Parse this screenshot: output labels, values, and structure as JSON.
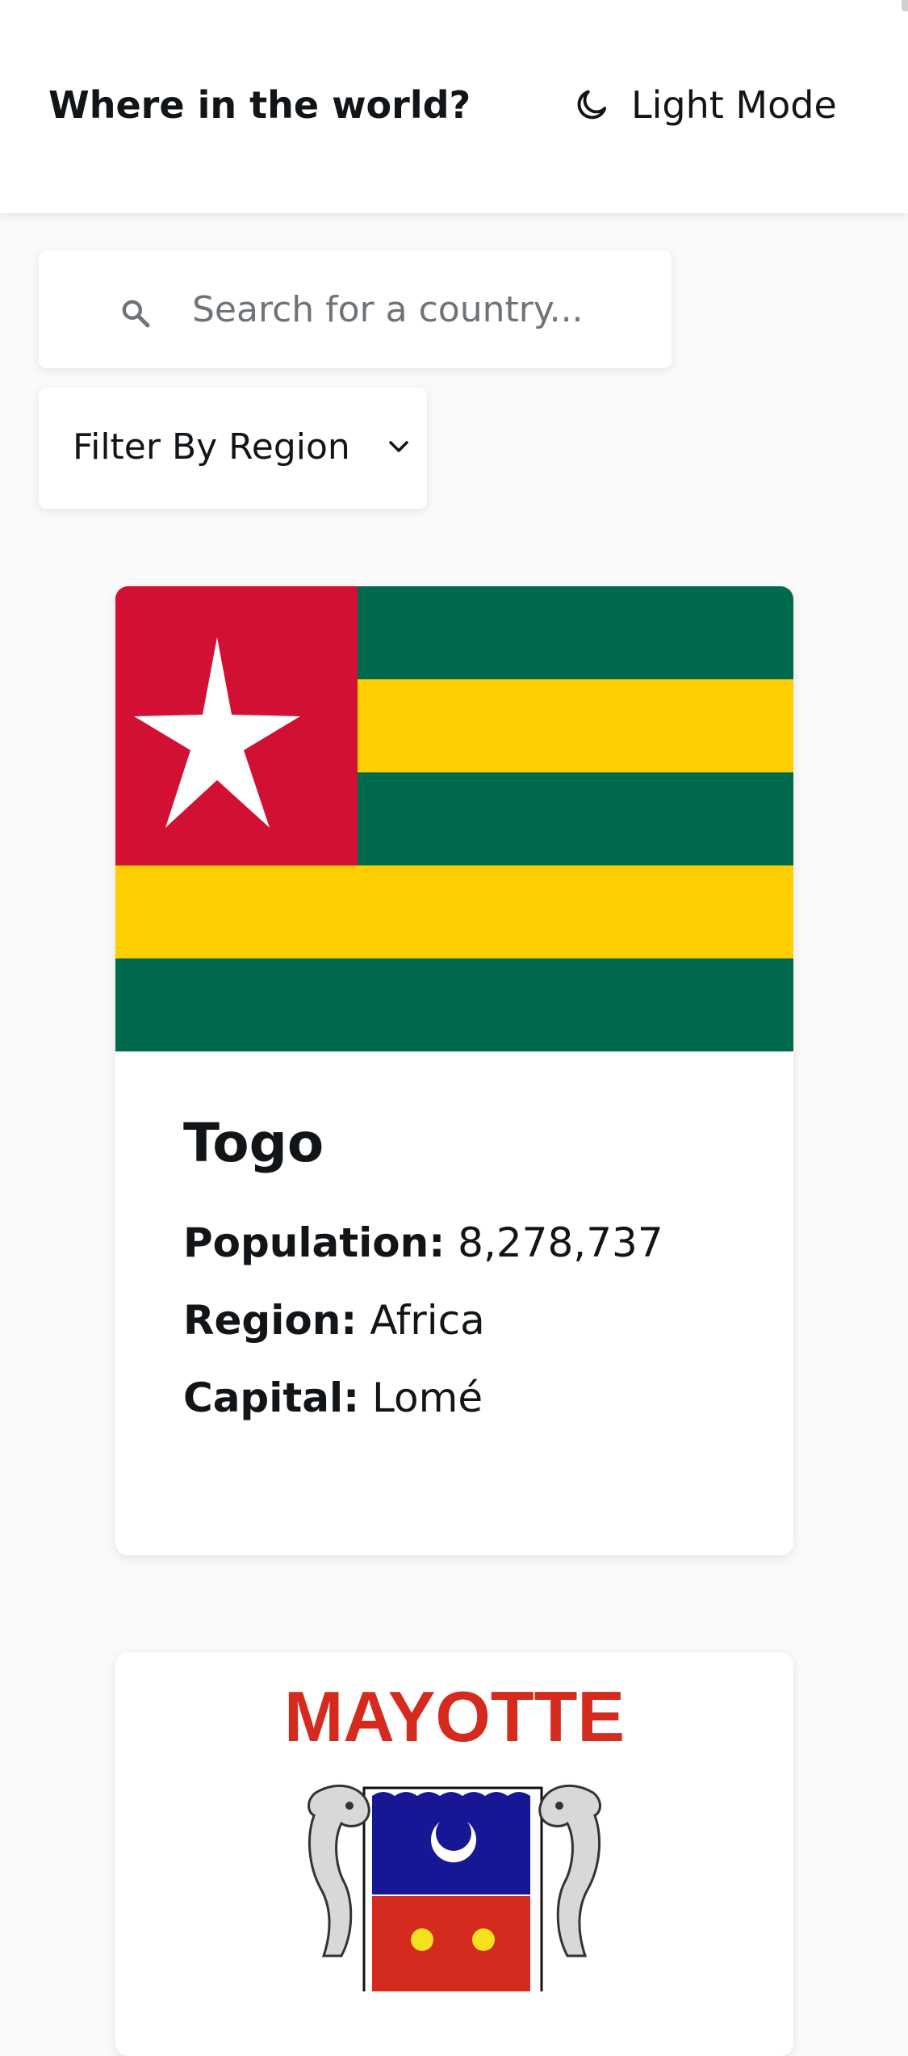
{
  "header": {
    "title": "Where in the world?",
    "mode_label": "Light Mode"
  },
  "search": {
    "placeholder": "Search for a country..."
  },
  "filter": {
    "selected_label": "Filter By Region"
  },
  "countries": [
    {
      "name": "Togo",
      "population_label": "Population:",
      "population": "8,278,737",
      "region_label": "Region:",
      "region": "Africa",
      "capital_label": "Capital:",
      "capital": "Lomé",
      "flag_colors": {
        "green": "#006a4e",
        "yellow": "#ffce00",
        "red": "#d21034",
        "star": "#ffffff"
      }
    },
    {
      "flag_text": "MAYOTTE",
      "flag_colors": {
        "text": "#d52b1e",
        "shield_blue": "#171796",
        "shield_red": "#d52b1e"
      }
    }
  ],
  "icons": {
    "mode": "moon-icon",
    "search": "search-icon",
    "filter": "chevron-down-icon"
  }
}
